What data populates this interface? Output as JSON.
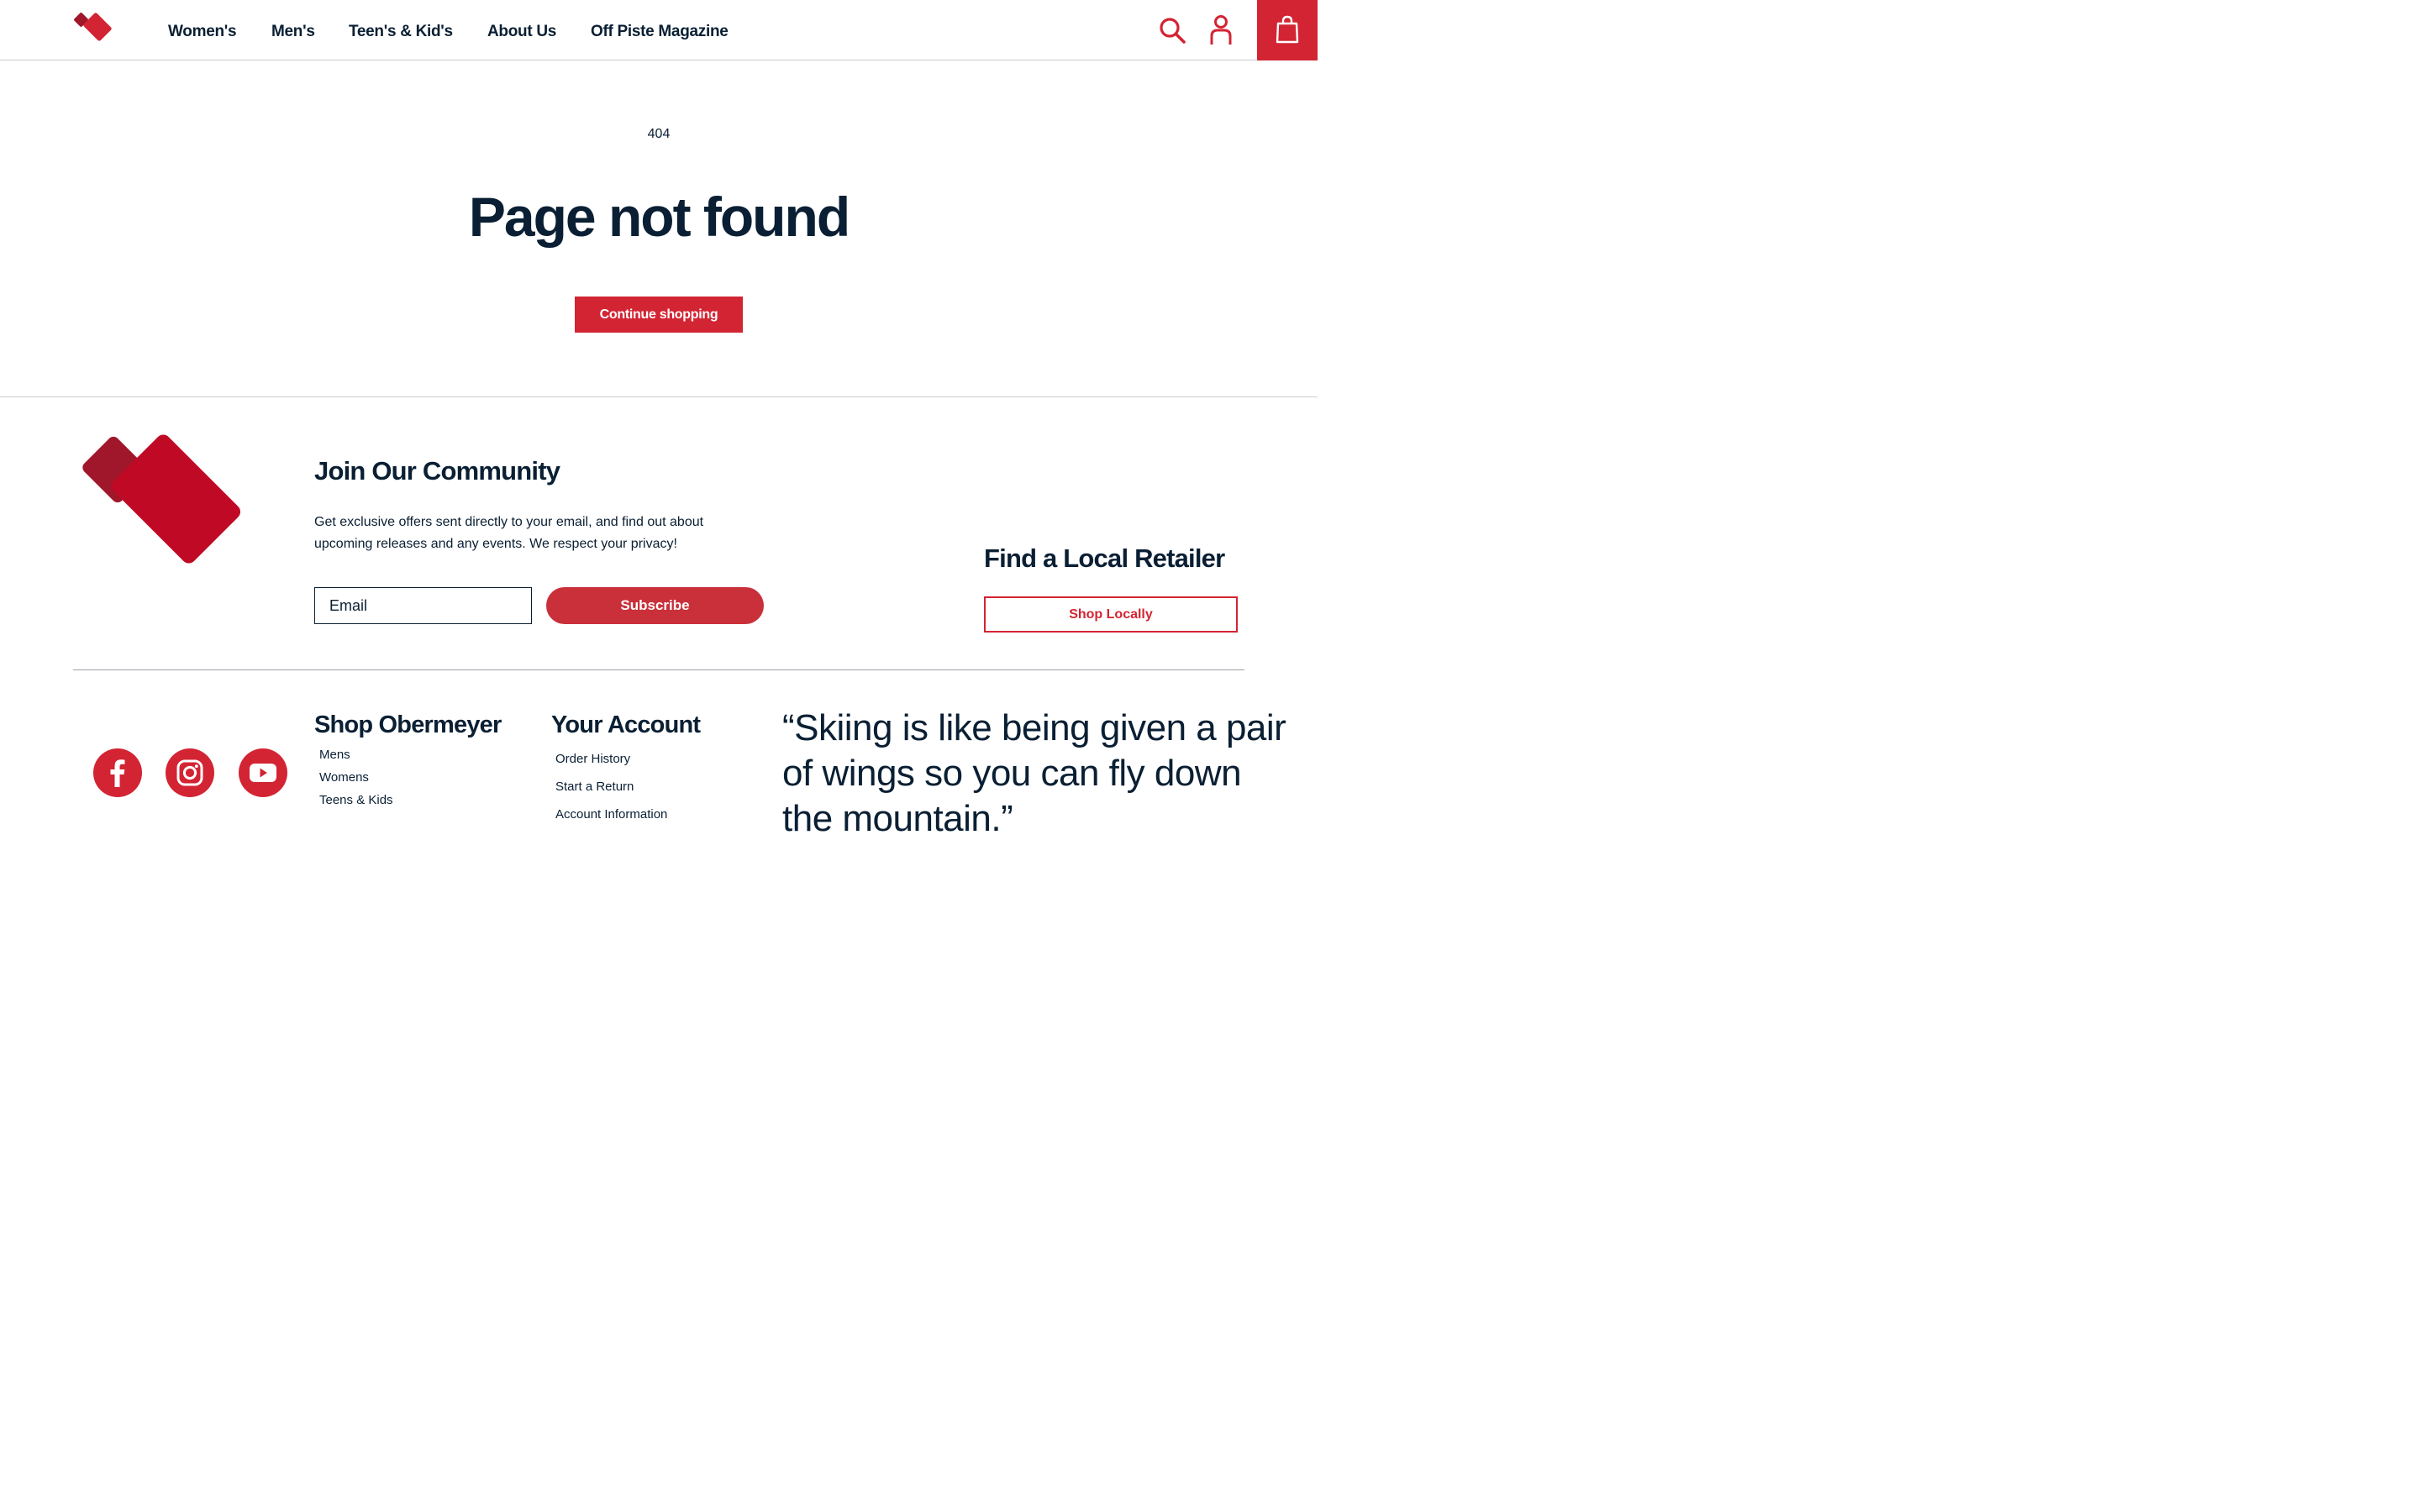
{
  "colors": {
    "brand_red": "#d32433",
    "dark_red": "#a0162a",
    "navy": "#0a1f33"
  },
  "header": {
    "nav": [
      {
        "label": "Women's"
      },
      {
        "label": "Men's"
      },
      {
        "label": "Teen's & Kid's"
      },
      {
        "label": "About Us"
      },
      {
        "label": "Off Piste Magazine"
      }
    ],
    "icons": [
      "logo-icon",
      "search-icon",
      "account-icon",
      "cart-icon"
    ]
  },
  "main": {
    "code": "404",
    "title": "Page not found",
    "continue_label": "Continue shopping"
  },
  "footer": {
    "join_title": "Join Our Community",
    "join_text": "Get exclusive offers sent directly to your email, and find out about upcoming releases and any events. We respect your privacy!",
    "email_placeholder": "Email",
    "subscribe_label": "Subscribe",
    "retailer_title": "Find a Local Retailer",
    "shop_locally_label": "Shop Locally",
    "social_icons": [
      "facebook-icon",
      "instagram-icon",
      "youtube-icon"
    ],
    "shop_title": "Shop Obermeyer",
    "shop_links": [
      "Mens",
      "Womens",
      "Teens & Kids"
    ],
    "account_title": "Your Account",
    "account_links": [
      "Order History",
      "Start a Return",
      "Account Information"
    ],
    "quote": "“Skiing is like being given a pair of wings so you can fly down the mountain.”"
  }
}
